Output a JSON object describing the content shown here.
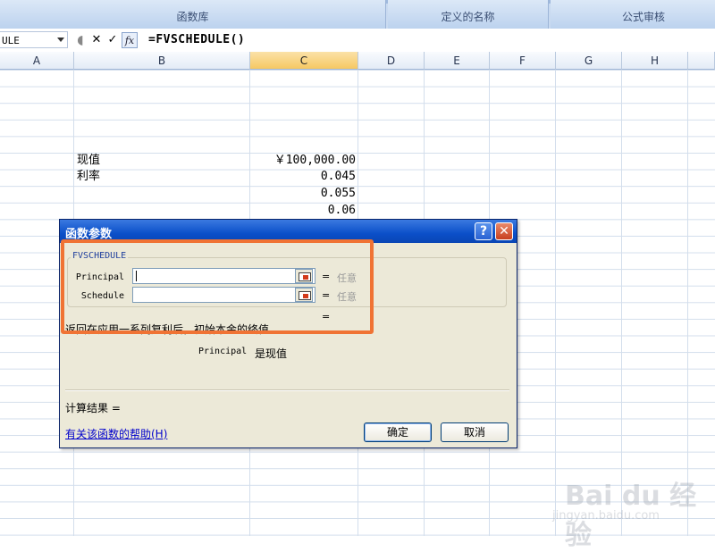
{
  "ribbon": {
    "groups": [
      "函数库",
      "定义的名称",
      "公式审核"
    ]
  },
  "formula_bar": {
    "name_box": "ULE",
    "cancel_glyph": "✕",
    "enter_glyph": "✓",
    "fx_label": "fx",
    "formula": "=FVSCHEDULE()"
  },
  "columns": [
    "A",
    "B",
    "C",
    "D",
    "E",
    "F",
    "G",
    "H"
  ],
  "selected_column": "C",
  "cells": {
    "b_present_value": "现值",
    "b_rate": "利率",
    "c_present_value": "￥100,000.00",
    "c_rate1": "0.045",
    "c_rate2": "0.055",
    "c_rate3": "0.06"
  },
  "dialog": {
    "title": "函数参数",
    "help_glyph": "?",
    "close_glyph": "✕",
    "function_name": "FVSCHEDULE",
    "args": [
      {
        "label": "Principal",
        "value": "",
        "eq": "=",
        "result": "任意"
      },
      {
        "label": "Schedule",
        "value": "",
        "eq": "=",
        "result": "任意"
      }
    ],
    "result_eq": "=",
    "description": "返回在应用一系列复利后，初始本金的终值",
    "param_name": "Principal",
    "param_desc": "是现值",
    "calc_result": "计算结果 =",
    "help_link": "有关该函数的帮助(H)",
    "ok_label": "确定",
    "cancel_label": "取消"
  },
  "highlight_color": "#f07334",
  "watermark": {
    "brand": "Bai du 经验",
    "url": "jingyan.baidu.com"
  }
}
